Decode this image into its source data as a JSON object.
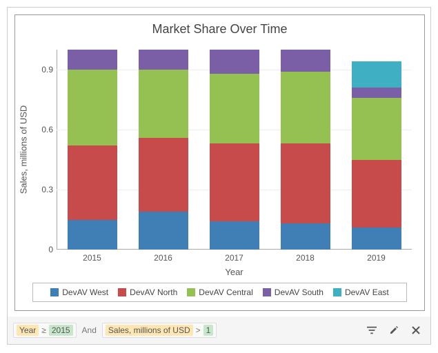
{
  "chart_data": {
    "type": "bar",
    "stacked": true,
    "title": "Market Share Over Time",
    "xlabel": "Year",
    "ylabel": "Sales, millions of USD",
    "ylim": [
      0,
      1.0
    ],
    "yticks": [
      0,
      0.3,
      0.6,
      0.9
    ],
    "categories": [
      "2015",
      "2016",
      "2017",
      "2018",
      "2019"
    ],
    "series": [
      {
        "name": "DevAV West",
        "color": "#3f7fb5",
        "values": [
          0.15,
          0.19,
          0.14,
          0.13,
          0.11
        ]
      },
      {
        "name": "DevAV North",
        "color": "#c84b4b",
        "values": [
          0.37,
          0.37,
          0.39,
          0.4,
          0.34
        ]
      },
      {
        "name": "DevAV Central",
        "color": "#95c153",
        "values": [
          0.38,
          0.34,
          0.35,
          0.36,
          0.31
        ]
      },
      {
        "name": "DevAV South",
        "color": "#7b5fa6",
        "values": [
          0.1,
          0.1,
          0.12,
          0.11,
          0.05
        ]
      },
      {
        "name": "DevAV East",
        "color": "#3fb0c4",
        "values": [
          0.0,
          0.0,
          0.0,
          0.0,
          0.13
        ]
      }
    ],
    "legend_position": "bottom"
  },
  "filter": {
    "conditions": [
      {
        "field": "Year",
        "op": "≥",
        "value": "2015"
      },
      {
        "field": "Sales, millions of USD",
        "op": ">",
        "value": "1"
      }
    ],
    "joiner": "And"
  }
}
